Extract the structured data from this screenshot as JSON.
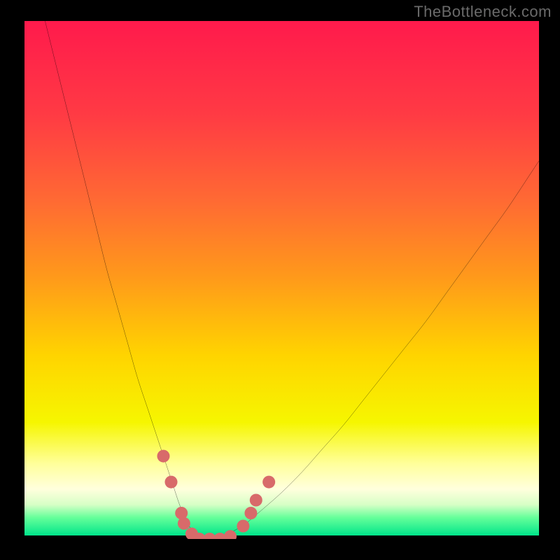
{
  "watermark": "TheBottleneck.com",
  "chart_data": {
    "type": "line",
    "title": "",
    "xlabel": "",
    "ylabel": "",
    "xlim": [
      0,
      100
    ],
    "ylim": [
      0,
      100
    ],
    "grid": false,
    "legend": false,
    "gradient_stops": [
      {
        "offset": 0.0,
        "color": "#ff1a4c"
      },
      {
        "offset": 0.18,
        "color": "#ff3a44"
      },
      {
        "offset": 0.35,
        "color": "#ff6a33"
      },
      {
        "offset": 0.5,
        "color": "#ff9a1a"
      },
      {
        "offset": 0.65,
        "color": "#ffd400"
      },
      {
        "offset": 0.78,
        "color": "#f6f600"
      },
      {
        "offset": 0.86,
        "color": "#ffff9a"
      },
      {
        "offset": 0.91,
        "color": "#ffffdd"
      },
      {
        "offset": 0.94,
        "color": "#d7ffc6"
      },
      {
        "offset": 0.965,
        "color": "#66ff9a"
      },
      {
        "offset": 1.0,
        "color": "#00e58a"
      }
    ],
    "series": [
      {
        "name": "bottleneck-curve",
        "color": "#000000",
        "width": 2,
        "x": [
          4,
          6,
          8,
          10,
          12,
          14,
          16,
          18,
          20,
          22,
          24,
          26,
          28,
          29,
          30,
          31,
          32,
          33,
          34,
          35,
          36,
          38,
          40,
          43,
          46,
          50,
          54,
          58,
          62,
          66,
          70,
          74,
          78,
          82,
          86,
          90,
          94,
          98,
          100
        ],
        "y": [
          100,
          92,
          84,
          76,
          68,
          60,
          52,
          45,
          38,
          31,
          25,
          19,
          13,
          10,
          7,
          4.5,
          2.5,
          1.2,
          0.4,
          0,
          0,
          0.4,
          1.2,
          3,
          5.5,
          9,
          13,
          17.5,
          22,
          27,
          32,
          37,
          42,
          47.5,
          53,
          58.5,
          64,
          70,
          73
        ]
      }
    ],
    "markers": {
      "color": "#d86a6a",
      "radius_px": 9,
      "points": [
        {
          "x": 27.0,
          "y": 16.0
        },
        {
          "x": 28.5,
          "y": 11.0
        },
        {
          "x": 30.5,
          "y": 5.0
        },
        {
          "x": 31.0,
          "y": 3.0
        },
        {
          "x": 32.5,
          "y": 1.0
        },
        {
          "x": 34.0,
          "y": 0.0
        },
        {
          "x": 36.0,
          "y": 0.0
        },
        {
          "x": 38.0,
          "y": 0.0
        },
        {
          "x": 40.0,
          "y": 0.5
        },
        {
          "x": 42.5,
          "y": 2.5
        },
        {
          "x": 44.0,
          "y": 5.0
        },
        {
          "x": 45.0,
          "y": 7.5
        },
        {
          "x": 47.5,
          "y": 11.0
        }
      ]
    }
  }
}
